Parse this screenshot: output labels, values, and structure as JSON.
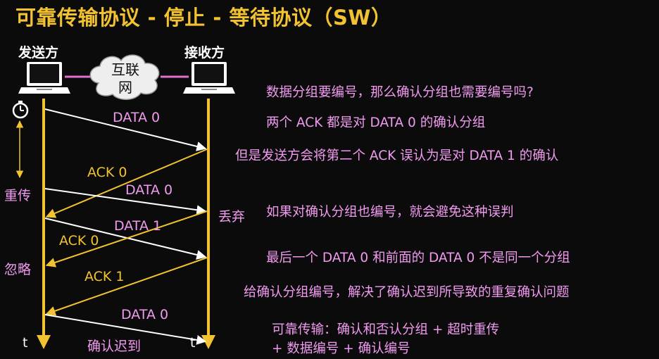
{
  "title": "可靠传输协议 - 停止 - 等待协议（SW）",
  "sender": "发送方",
  "receiver": "接收方",
  "network_line1": "互联",
  "network_line2": "网",
  "labels": {
    "data0_first": "DATA 0",
    "ack0_first": "ACK 0",
    "data0_resend": "DATA 0",
    "data1": "DATA 1",
    "ack0_second": "ACK 0",
    "ack1": "ACK 1",
    "data0_last": "DATA 0"
  },
  "side": {
    "retransmit": "重传",
    "ignore": "忽略",
    "discard": "丢弃",
    "late_ack": "确认迟到",
    "t_left": "t",
    "t_right": "t"
  },
  "notes": [
    "数据分组要编号，那么确认分组也需要编号吗?",
    "两个 ACK 都是对 DATA 0 的确认分组",
    "但是发送方会将第二个 ACK 误认为是对 DATA 1 的确认",
    "如果对确认分组也编号，就会避免这种误判",
    "最后一个 DATA 0 和前面的 DATA 0 不是同一个分组",
    "给确认分组编号，解决了确认迟到所导致的重复确认问题",
    "可靠传输：确认和否认分组 + 超时重传",
    "+ 数据编号 + 确认编号"
  ],
  "icons": [
    "laptop-icon",
    "cloud-icon",
    "stopwatch-icon"
  ],
  "colors": {
    "title": "#f2c230",
    "timeline": "#f2c230",
    "data_arrow": "#ffffff",
    "ack_arrow": "#f2c230",
    "annotation": "#f19af0"
  }
}
